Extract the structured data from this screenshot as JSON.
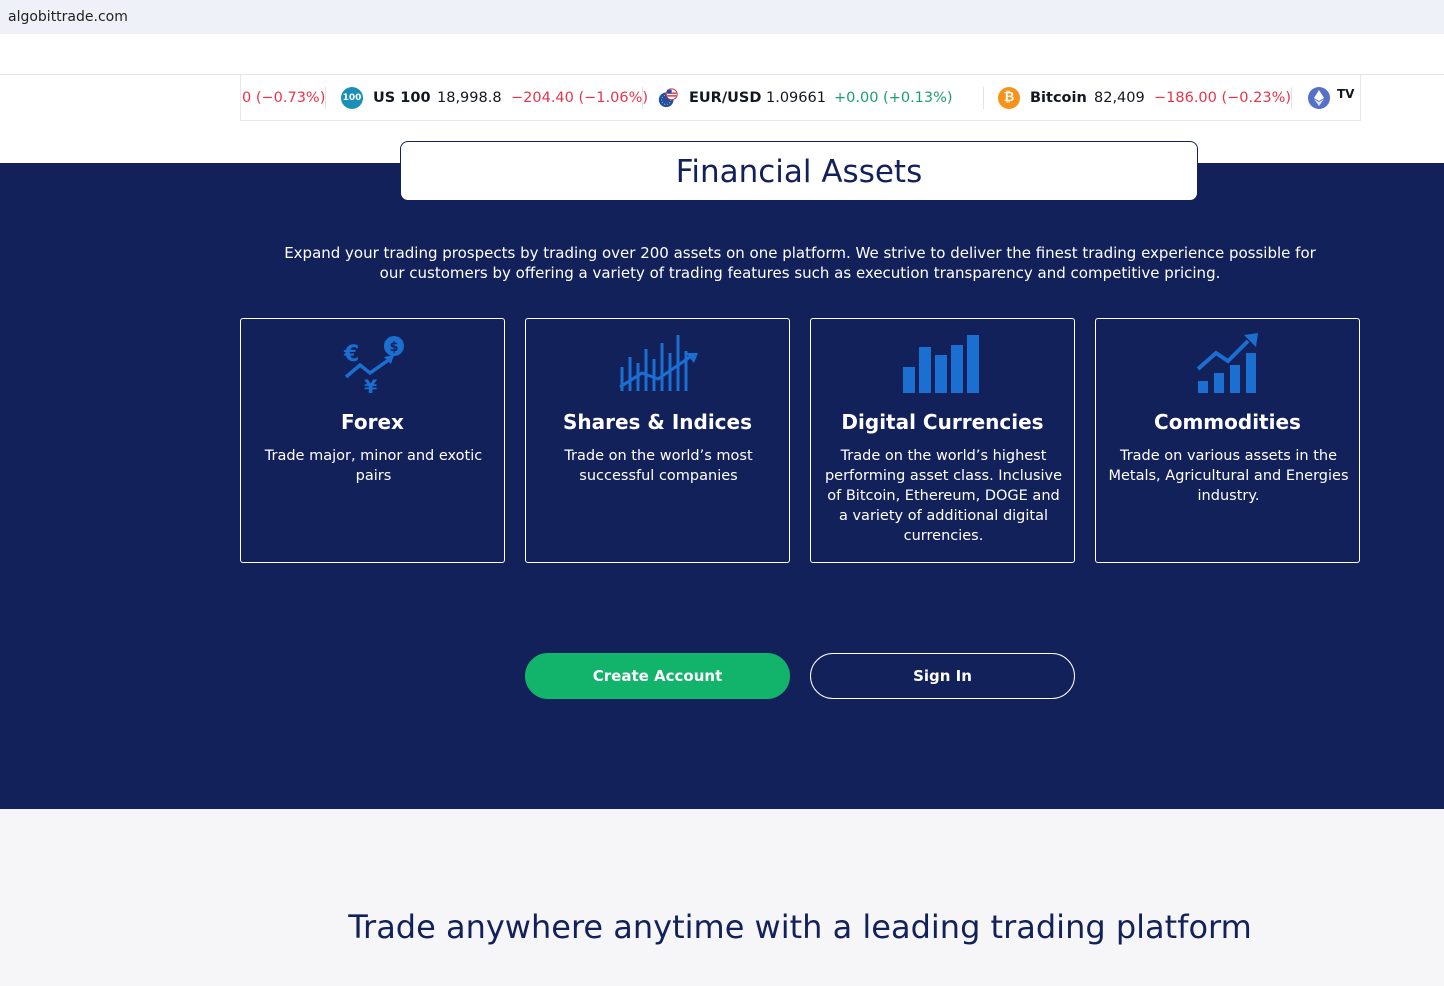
{
  "browser": {
    "url": "algobittrade.com"
  },
  "ticker": {
    "partial": "0 (−0.73%)",
    "items": [
      {
        "icon": "100",
        "symbol": "US 100",
        "price": "18,998.8",
        "change": "−204.40 (−1.06%)"
      },
      {
        "icon": "eur-usd-flag-icon",
        "symbol": "EUR/USD",
        "price": "1.09661",
        "change": "+0.00 (+0.13%)"
      },
      {
        "icon": "bitcoin-icon",
        "symbol": "Bitcoin",
        "price": "82,409",
        "change": "−186.00 (−0.23%)"
      }
    ],
    "brand": "TV"
  },
  "section": {
    "title": "Financial Assets",
    "intro": "Expand your trading prospects by trading over 200 assets on one platform. We strive to deliver the finest trading experience possible for our customers by offering a variety of trading features such as execution transparency and competitive pricing."
  },
  "cards": [
    {
      "icon": "forex-icon",
      "title": "Forex",
      "text": "Trade major, minor and exotic pairs"
    },
    {
      "icon": "shares-chart-icon",
      "title": "Shares & Indices",
      "text": "Trade on the world’s most successful companies"
    },
    {
      "icon": "bar-chart-icon",
      "title": "Digital Currencies",
      "text": "Trade on the world’s highest performing asset class. Inclusive of Bitcoin, Ethereum, DOGE and a variety of additional digital currencies."
    },
    {
      "icon": "growth-chart-icon",
      "title": "Commodities",
      "text": "Trade on various assets in the Metals, Agricultural and Energies industry."
    }
  ],
  "actions": {
    "create_account": "Create Account",
    "sign_in": "Sign In"
  },
  "lower": {
    "headline": "Trade anywhere anytime with a leading trading platform"
  },
  "colors": {
    "navy": "#13215b",
    "green": "#12b36b",
    "icon_blue": "#1a6fd1",
    "negative": "#e8344a",
    "positive": "#1a9e73"
  }
}
